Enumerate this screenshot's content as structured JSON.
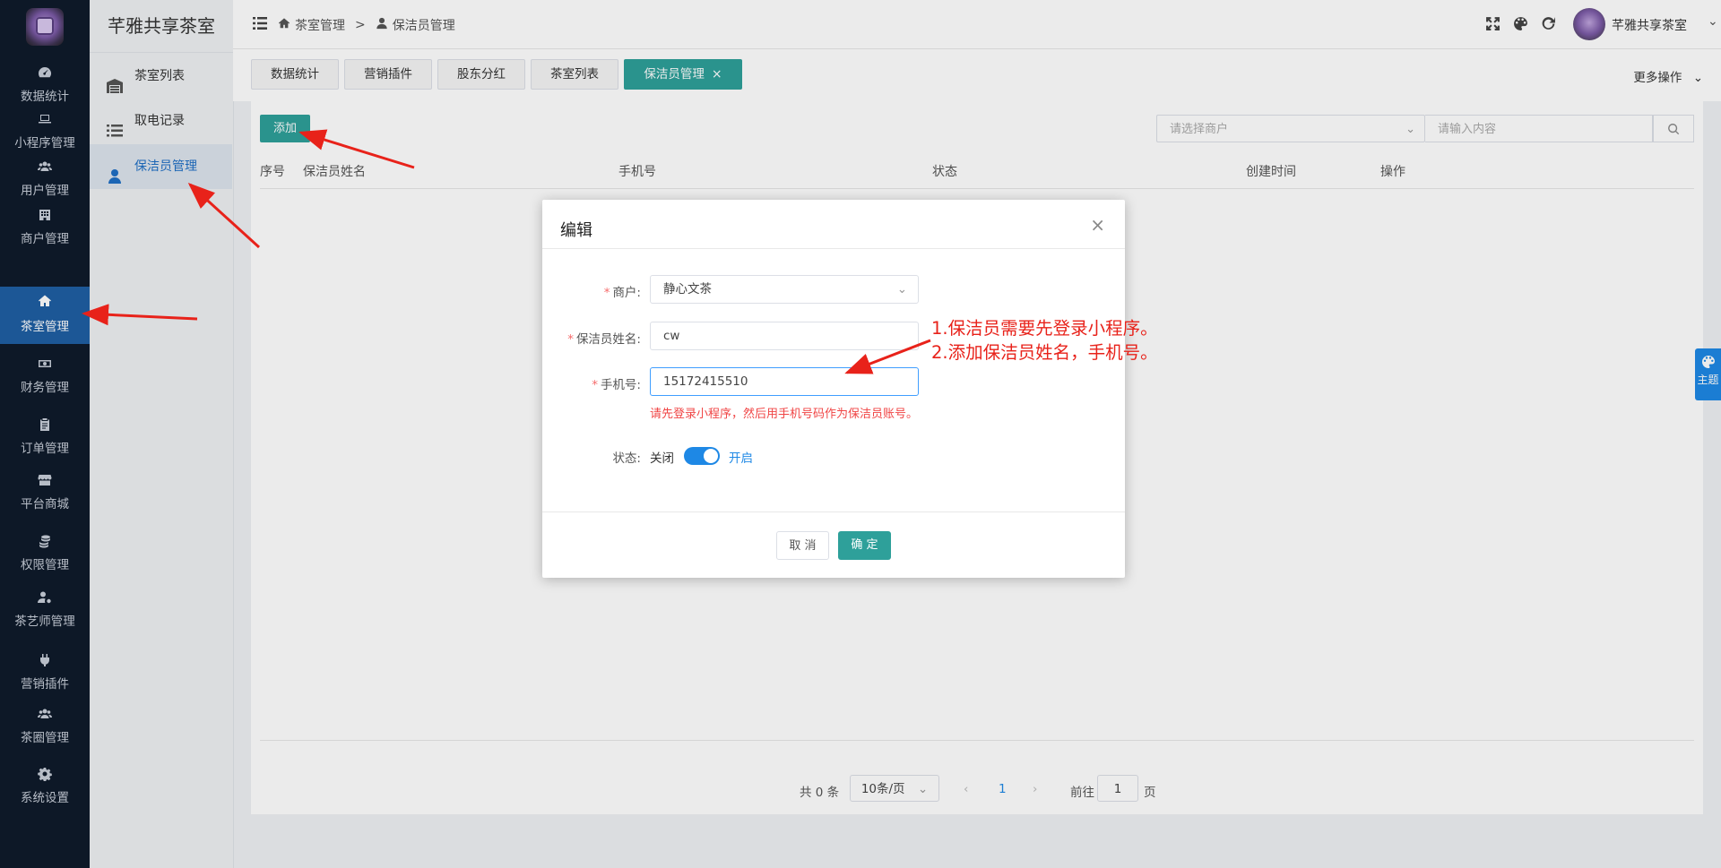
{
  "app": {
    "brand": "芊雅共享茶室"
  },
  "sidebar": {
    "items": [
      {
        "label": "数据统计",
        "icon": "dashboard-icon"
      },
      {
        "label": "小程序管理",
        "icon": "laptop-icon"
      },
      {
        "label": "用户管理",
        "icon": "users-icon"
      },
      {
        "label": "商户管理",
        "icon": "building-icon"
      },
      {
        "label": "茶室管理",
        "icon": "home-icon"
      },
      {
        "label": "财务管理",
        "icon": "money-icon"
      },
      {
        "label": "订单管理",
        "icon": "clipboard-icon"
      },
      {
        "label": "平台商城",
        "icon": "store-icon"
      },
      {
        "label": "权限管理",
        "icon": "coins-icon"
      },
      {
        "label": "茶艺师管理",
        "icon": "user-cog-icon"
      },
      {
        "label": "营销插件",
        "icon": "plug-icon"
      },
      {
        "label": "茶圈管理",
        "icon": "group-icon"
      },
      {
        "label": "系统设置",
        "icon": "gear-icon"
      }
    ],
    "active_index": 4
  },
  "subnav": {
    "items": [
      {
        "label": "茶室列表",
        "icon": "warehouse-icon"
      },
      {
        "label": "取电记录",
        "icon": "list-icon"
      },
      {
        "label": "保洁员管理",
        "icon": "user-icon"
      }
    ],
    "active_index": 2
  },
  "header": {
    "breadcrumb": [
      "茶室管理",
      ">",
      "保洁员管理"
    ],
    "user_name": "芊雅共享茶室"
  },
  "tabs": {
    "items": [
      {
        "label": "数据统计"
      },
      {
        "label": "营销插件"
      },
      {
        "label": "股东分红"
      },
      {
        "label": "茶室列表"
      },
      {
        "label": "保洁员管理"
      }
    ],
    "active_index": 4,
    "close_symbol": "×",
    "more_label": "更多操作"
  },
  "toolbar": {
    "add_label": "添加",
    "merchant_placeholder": "请选择商户",
    "search_placeholder": "请输入内容"
  },
  "table": {
    "columns": [
      "序号",
      "保洁员姓名",
      "手机号",
      "状态",
      "创建时间",
      "操作"
    ]
  },
  "pagination": {
    "total_text": "共 0 条",
    "page_size": "10条/页",
    "current_page": "1",
    "goto_label": "前往",
    "goto_value": "1",
    "page_suffix": "页"
  },
  "modal": {
    "title": "编辑",
    "close_symbol": "×",
    "fields": {
      "merchant_label": "商户:",
      "merchant_value": "静心文茶",
      "name_label": "保洁员姓名:",
      "name_value": "cw",
      "phone_label": "手机号:",
      "phone_value": "15172415510",
      "phone_hint": "请先登录小程序，然后用手机号码作为保洁员账号。",
      "status_label": "状态:",
      "status_off": "关闭",
      "status_on": "开启",
      "status_enabled": true
    },
    "cancel_label": "取 消",
    "ok_label": "确 定"
  },
  "annotation": {
    "line1": "1.保洁员需要先登录小程序。",
    "line2": "2.添加保洁员姓名，手机号。"
  },
  "theme_tab": {
    "label": "主题"
  },
  "colors": {
    "accent": "#2ea09a",
    "sidebar_bg": "#0f1b2b",
    "sidebar_active": "#1f5fa3",
    "annotation": "#e8221a"
  }
}
